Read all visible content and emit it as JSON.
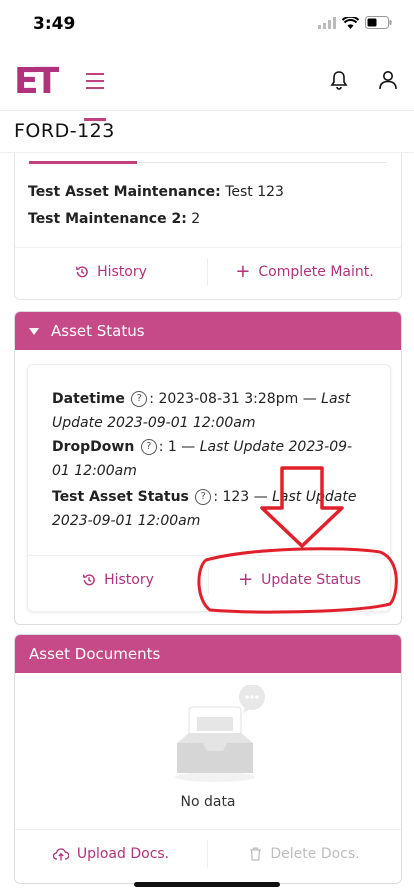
{
  "status_bar": {
    "time": "3:49"
  },
  "header": {
    "logo": "ET"
  },
  "page_title": "FORD-123",
  "maintenance_card": {
    "fields": [
      {
        "label": "Test Asset Maintenance:",
        "value": "Test 123"
      },
      {
        "label": "Test Maintenance 2:",
        "value": "2"
      }
    ],
    "history_label": "History",
    "complete_label": "Complete Maint."
  },
  "asset_status": {
    "title": "Asset Status",
    "rows": [
      {
        "label": "Datetime",
        "value": ": 2023-08-31 3:28pm — ",
        "updated": "Last Update 2023-09-01 12:00am"
      },
      {
        "label": "DropDown",
        "value": ": 1 — ",
        "updated": "Last Update 2023-09-01 12:00am"
      },
      {
        "label": "Test Asset Status",
        "value": ": 123 — ",
        "updated": "Last Update 2023-09-01 12:00am"
      }
    ],
    "history_label": "History",
    "update_label": "Update Status"
  },
  "asset_documents": {
    "title": "Asset Documents",
    "empty_text": "No data",
    "upload_label": "Upload Docs.",
    "delete_label": "Delete Docs."
  },
  "colors": {
    "accent": "#c2407f",
    "annotation": "#e0202a"
  }
}
